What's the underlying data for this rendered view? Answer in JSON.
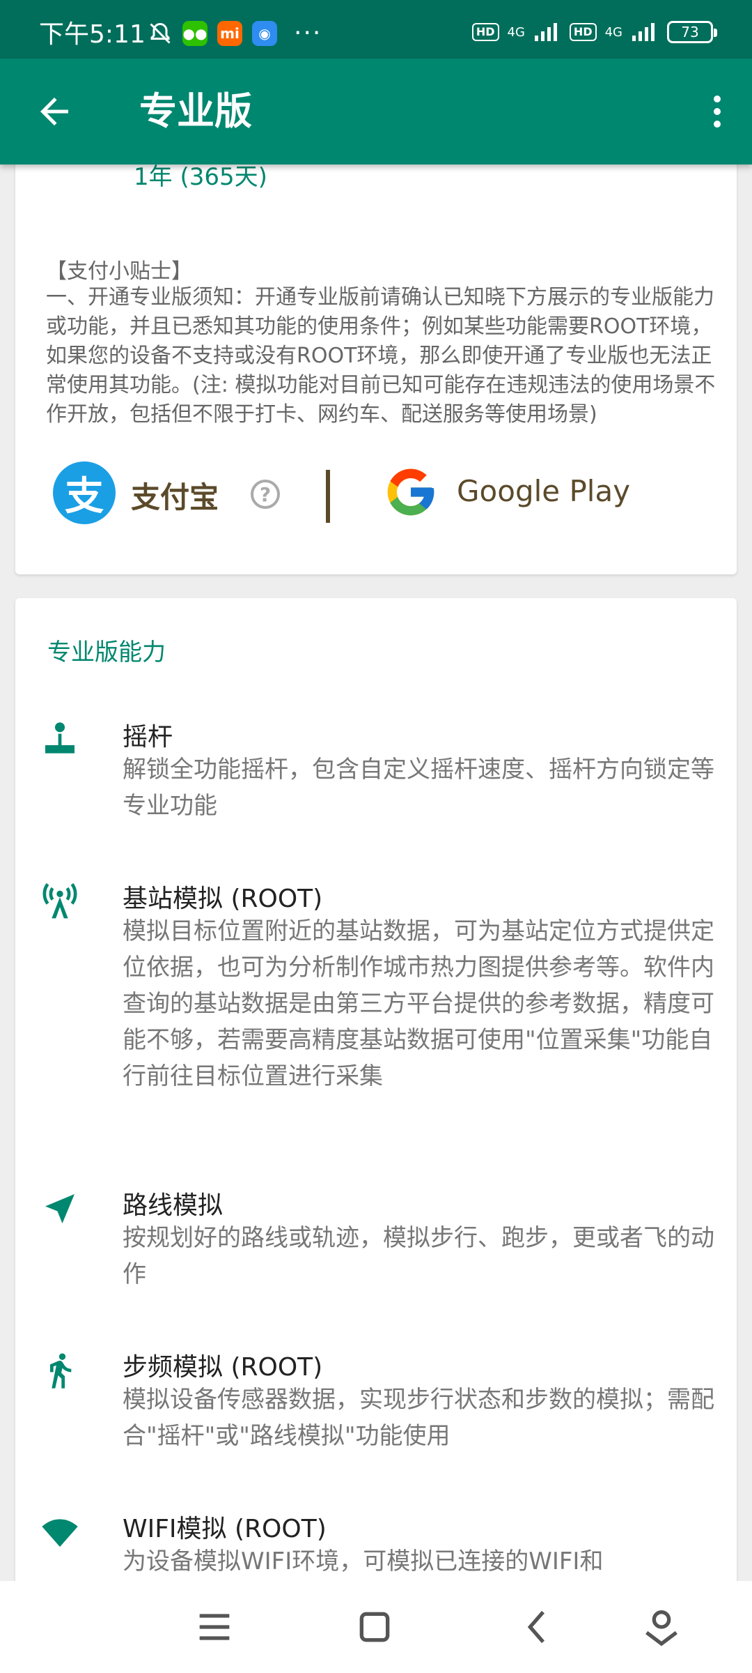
{
  "status_bar": {
    "time": "下午5:11",
    "apps": [
      "bell-off-icon",
      "wechat-icon",
      "mi-icon",
      "app-icon"
    ],
    "mi_label": "mi",
    "more": "···",
    "hd": "HD",
    "net": "4G",
    "battery": "73"
  },
  "app_bar": {
    "title": "专业版"
  },
  "plan_partial": "1年 (365天)",
  "tips": {
    "title": "【支付小贴士】",
    "body": "一、开通专业版须知：开通专业版前请确认已知晓下方展示的专业版能力或功能，并且已悉知其功能的使用条件；例如某些功能需要ROOT环境，如果您的设备不支持或没有ROOT环境，那么即使开通了专业版也无法正常使用其功能。(注: 模拟功能对目前已知可能存在违规违法的使用场景不作开放，包括但不限于打卡、网约车、配送服务等使用场景)"
  },
  "payment": {
    "alipay_glyph": "支",
    "alipay_label": "支付宝",
    "help": "?",
    "google_label": "Google Play"
  },
  "capabilities": {
    "title": "专业版能力",
    "items": [
      {
        "icon": "joystick-icon",
        "title": "摇杆",
        "desc": "解锁全功能摇杆，包含自定义摇杆速度、摇杆方向锁定等专业功能"
      },
      {
        "icon": "cell-tower-icon",
        "title": "基站模拟 (ROOT)",
        "desc": "模拟目标位置附近的基站数据，可为基站定位方式提供定位依据，也可为分析制作城市热力图提供参考等。软件内查询的基站数据是由第三方平台提供的参考数据，精度可能不够，若需要高精度基站数据可使用\"位置采集\"功能自行前往目标位置进行采集"
      },
      {
        "icon": "navigation-arrow-icon",
        "title": "路线模拟",
        "desc": "按规划好的路线或轨迹，模拟步行、跑步，更或者飞的动作"
      },
      {
        "icon": "running-person-icon",
        "title": "步频模拟 (ROOT)",
        "desc": "模拟设备传感器数据，实现步行状态和步数的模拟；需配合\"摇杆\"或\"路线模拟\"功能使用"
      },
      {
        "icon": "wifi-icon",
        "title": "WIFI模拟 (ROOT)",
        "desc": "为设备模拟WIFI环境，可模拟已连接的WIFI和"
      }
    ]
  },
  "colors": {
    "primary": "#00876f",
    "status_bar": "#006e5b",
    "alipay": "#1a9fe5"
  }
}
